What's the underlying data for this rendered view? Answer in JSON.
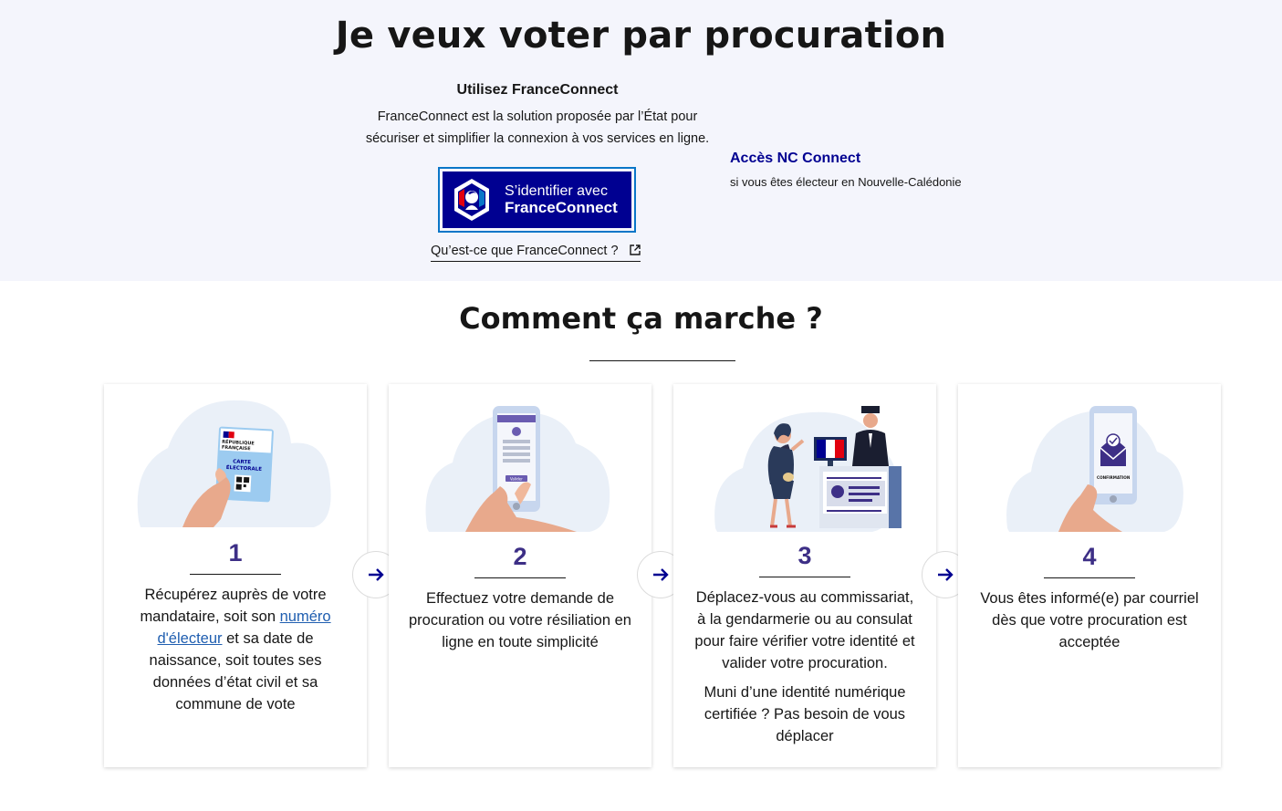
{
  "page": {
    "title": "Je veux voter par procuration"
  },
  "franceconnect": {
    "heading": "Utilisez FranceConnect",
    "description_line1": "FranceConnect est la solution proposée par l’État pour",
    "description_line2": "sécuriser et simplifier la connexion à vos services en ligne.",
    "button_line1": "S’identifier avec",
    "button_line2": "FranceConnect",
    "info_link": "Qu’est-ce que FranceConnect ?"
  },
  "nc_connect": {
    "title": "Accès NC Connect",
    "subtitle": "si vous êtes électeur en Nouvelle-Calédonie"
  },
  "how": {
    "title": "Comment ça marche ?",
    "steps": [
      {
        "number": "1",
        "text_before": "Récupérez auprès de votre mandataire, soit son ",
        "link": "numéro d'électeur",
        "text_after": " et sa date de naissance, soit toutes ses données d’état civil et sa commune de vote",
        "card_label_1": "RÉPUBLIQUE",
        "card_label_2": "FRANÇAISE",
        "card_label_3": "CARTE",
        "card_label_4": "ÉLECTORALE"
      },
      {
        "number": "2",
        "text": "Effectuez votre demande de procuration ou votre résiliation en ligne en toute simplicité",
        "phone_button": "Valider"
      },
      {
        "number": "3",
        "text": "Déplacez-vous au commissariat, à la gendarmerie ou au consulat pour faire vérifier votre identité et valider votre procuration.",
        "text2": "Muni d’une identité numérique certifiée ? Pas besoin de vous déplacer"
      },
      {
        "number": "4",
        "text": "Vous êtes informé(e) par courriel dès que votre procuration est acceptée",
        "phone_label": "CONFIRMATION"
      }
    ]
  },
  "colors": {
    "brand_blue": "#000091",
    "step_number": "#3d2f86",
    "top_background": "#f4f5fc",
    "link": "#1f5eb0"
  },
  "icons": {
    "arrow": "arrow-right-icon",
    "external": "external-link-icon",
    "fc_logo": "marianne-logo-icon"
  }
}
